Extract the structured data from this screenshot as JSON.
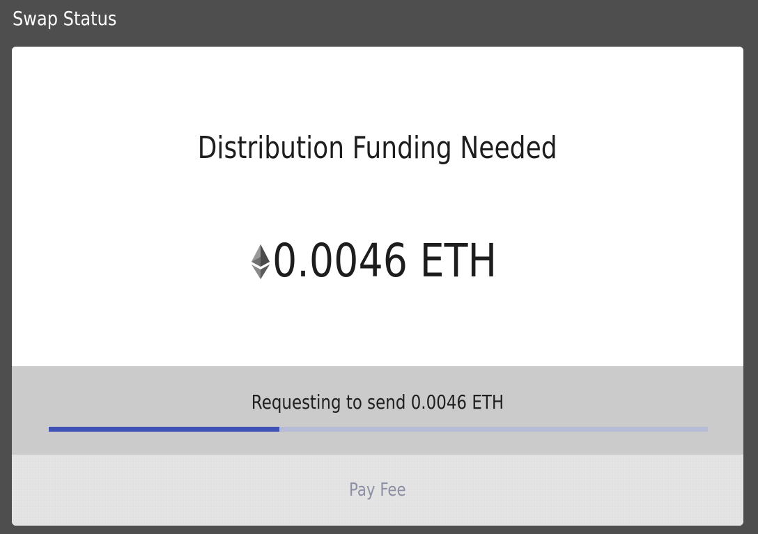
{
  "window": {
    "title": "Swap Status"
  },
  "card": {
    "title": "Distribution Funding Needed",
    "amount": {
      "icon": "ethereum-icon",
      "text": "0.0046 ETH"
    },
    "status": {
      "text": "Requesting to send 0.0046 ETH",
      "progress_fraction": 0.35
    },
    "action": {
      "label": "Pay Fee",
      "enabled": false
    }
  },
  "colors": {
    "window_background": "#4e4e4e",
    "status_band": "#cbcbcb",
    "progress_fill": "#3f51b5",
    "progress_track": "#b6bbd6",
    "button_disabled_text": "#8c8fa3"
  }
}
